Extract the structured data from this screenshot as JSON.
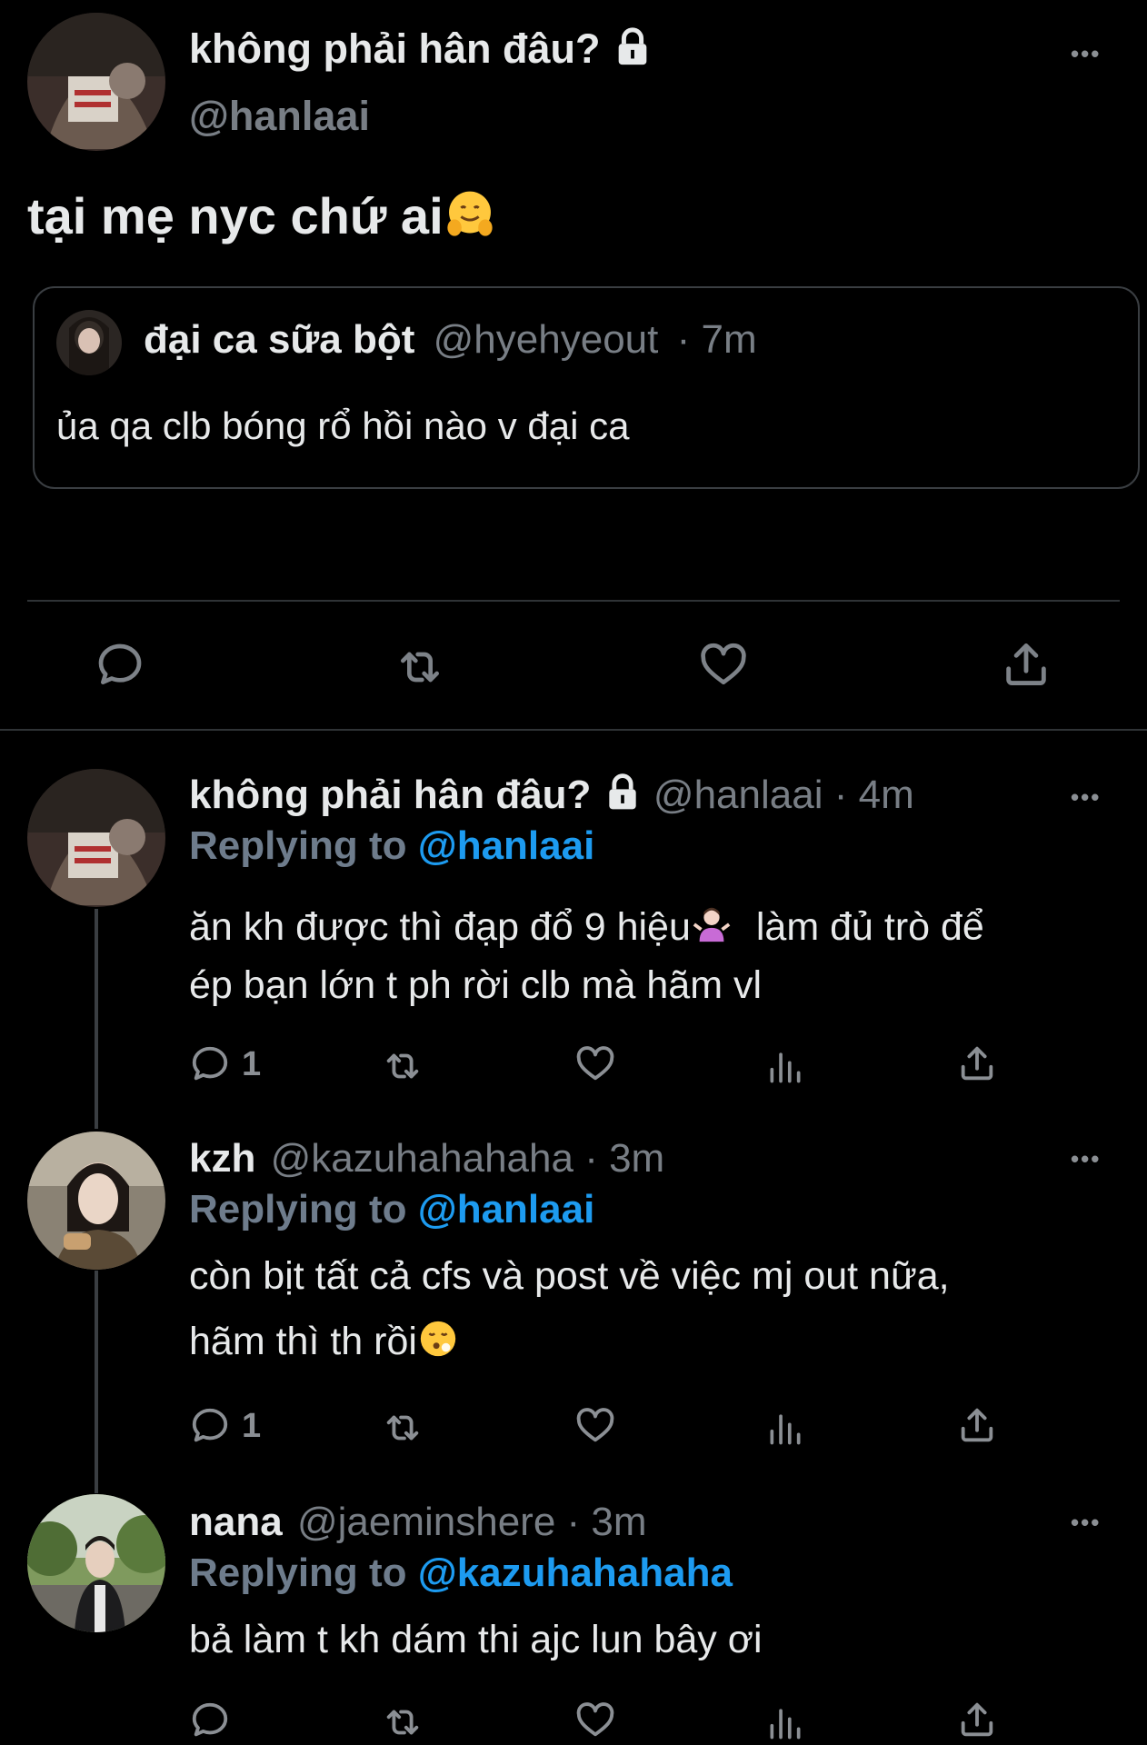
{
  "main_tweet": {
    "display_name": "không phải hân đâu?",
    "handle": "@hanlaai",
    "text": "tại mẹ nyc chứ ai",
    "more": "•••",
    "quote": {
      "display_name": "đại ca sữa bột",
      "handle": "@hyehyeout",
      "time": "· 7m",
      "text": "ủa qa clb bóng rổ hồi nào v đại ca"
    }
  },
  "replies": [
    {
      "display_name": "không phải hân đâu?",
      "handle": "@hanlaai",
      "time": "· 4m",
      "replying_label": "Replying to",
      "replying_to": "@hanlaai",
      "text_line1": "ăn kh được thì đạp đổ 9 hiệu",
      "text_line1b": "làm đủ trò để",
      "text_line2": "ép bạn lớn t ph rời clb mà hãm vl",
      "reply_count": "1"
    },
    {
      "display_name": "kzh",
      "handle": "@kazuhahahaha",
      "time": "· 3m",
      "replying_label": "Replying to",
      "replying_to": "@hanlaai",
      "text_line1": "còn bịt tất cả cfs và post về việc mj out nữa,",
      "text_line2": "hãm thì th rồi",
      "reply_count": "1"
    },
    {
      "display_name": "nana",
      "handle": "@jaeminshere",
      "time": "· 3m",
      "replying_label": "Replying to",
      "replying_to": "@kazuhahahaha",
      "text_line1": "bả làm t kh dám thi ajc lun bây ơi"
    }
  ],
  "colors": {
    "background": "#000000",
    "text": "#e7e9ea",
    "secondary": "#71767b",
    "accent": "#1d9bf0"
  },
  "icons": [
    "lock-icon",
    "reply-icon",
    "retweet-icon",
    "like-icon",
    "share-icon",
    "views-icon",
    "more-icon"
  ]
}
